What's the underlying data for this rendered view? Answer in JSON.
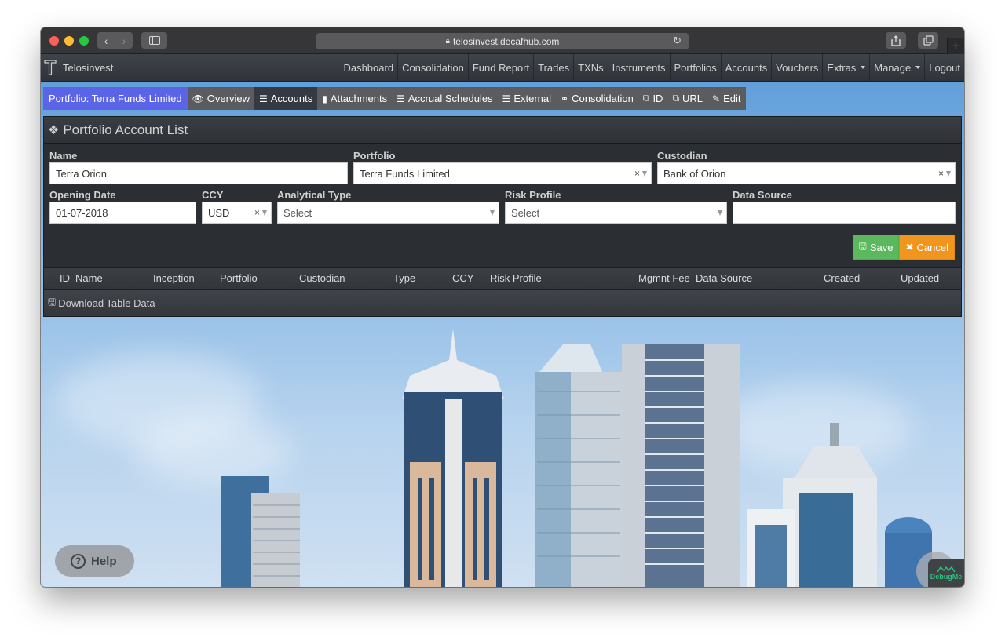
{
  "browser": {
    "url": "telosinvest.decafhub.com",
    "icons": {
      "back": "chevron-left-icon",
      "forward": "chevron-right-icon",
      "sidebar": "sidebar-icon",
      "lock": "lock-icon",
      "reload": "reload-icon",
      "share": "share-icon",
      "tabs": "tabs-icon",
      "new_tab": "plus-icon"
    }
  },
  "navbar": {
    "brand": "Telosinvest",
    "items": [
      {
        "label": "Dashboard"
      },
      {
        "label": "Consolidation"
      },
      {
        "label": "Fund Report"
      },
      {
        "label": "Trades"
      },
      {
        "label": "TXNs"
      },
      {
        "label": "Instruments"
      },
      {
        "label": "Portfolios"
      },
      {
        "label": "Accounts"
      },
      {
        "label": "Vouchers"
      },
      {
        "label": "Extras",
        "dropdown": true
      },
      {
        "label": "Manage",
        "dropdown": true
      },
      {
        "label": "Logout"
      }
    ]
  },
  "subnav": {
    "title": "Portfolio: Terra Funds Limited",
    "items": [
      {
        "label": "Overview",
        "icon": "eye-icon",
        "glyph": "👁"
      },
      {
        "label": "Accounts",
        "icon": "list-icon",
        "glyph": "☰",
        "active": true
      },
      {
        "label": "Attachments",
        "icon": "file-icon",
        "glyph": "▮"
      },
      {
        "label": "Accrual Schedules",
        "icon": "list-icon",
        "glyph": "☰"
      },
      {
        "label": "External",
        "icon": "list-icon",
        "glyph": "☰"
      },
      {
        "label": "Consolidation",
        "icon": "link-icon",
        "glyph": "⚭"
      },
      {
        "label": "ID",
        "icon": "copy-icon",
        "glyph": "⧉"
      },
      {
        "label": "URL",
        "icon": "copy-icon",
        "glyph": "⧉"
      },
      {
        "label": "Edit",
        "icon": "edit-icon",
        "glyph": "✎"
      }
    ]
  },
  "panel": {
    "title": "Portfolio Account List",
    "title_icon": "cubes-icon"
  },
  "form": {
    "name": {
      "label": "Name",
      "value": "Terra Orion"
    },
    "portfolio": {
      "label": "Portfolio",
      "value": "Terra Funds Limited"
    },
    "custodian": {
      "label": "Custodian",
      "value": "Bank of Orion"
    },
    "opening_date": {
      "label": "Opening Date",
      "value": "01-07-2018"
    },
    "ccy": {
      "label": "CCY",
      "value": "USD"
    },
    "analytical_type": {
      "label": "Analytical Type",
      "value": "Select"
    },
    "risk_profile": {
      "label": "Risk Profile",
      "value": "Select"
    },
    "data_source": {
      "label": "Data Source",
      "value": ""
    },
    "clear_glyph": "×",
    "save_label": "Save",
    "cancel_label": "Cancel"
  },
  "table": {
    "columns": [
      "ID",
      "Name",
      "Inception",
      "Portfolio",
      "Custodian",
      "Type",
      "CCY",
      "Risk Profile",
      "Mgmnt Fee",
      "Data Source",
      "Created",
      "Updated"
    ],
    "rows": [],
    "download_label": "Download Table Data"
  },
  "widgets": {
    "help_label": "Help",
    "debug_label": "DebugMe"
  }
}
